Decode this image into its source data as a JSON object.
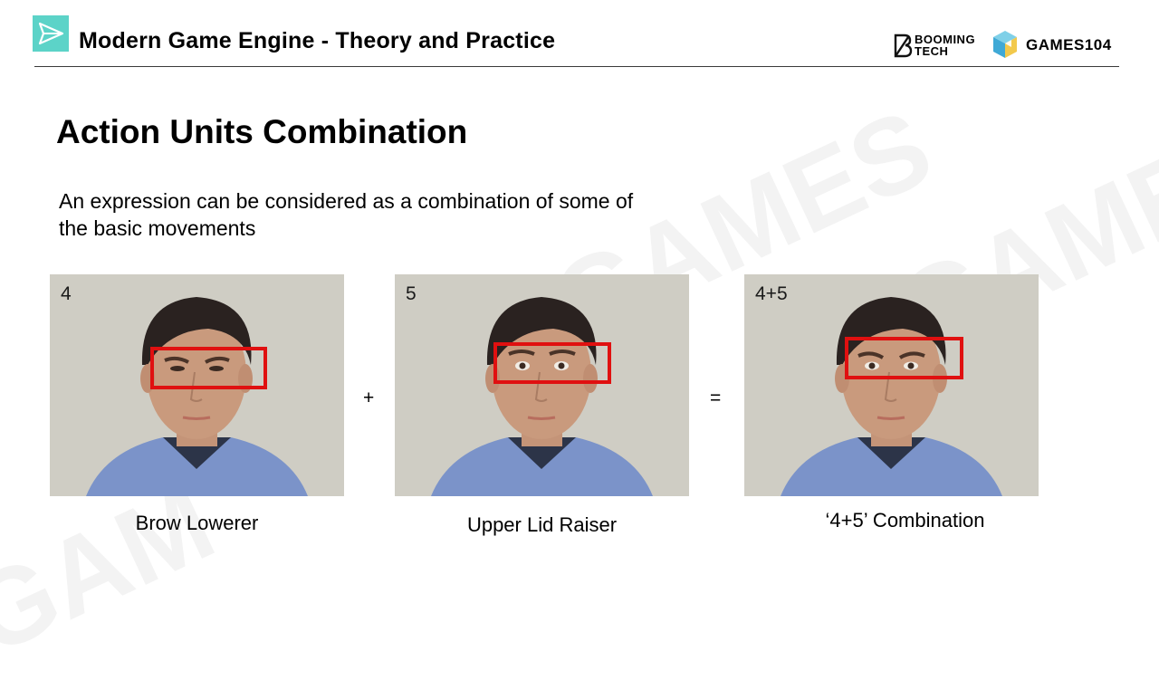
{
  "header": {
    "course_title": "Modern Game Engine - Theory and Practice",
    "brand_booming_line1": "BOOMING",
    "brand_booming_line2": "TECH",
    "brand_games": "GAMES104",
    "logo_icon": "paper-plane-icon"
  },
  "slide": {
    "title": "Action Units Combination",
    "body": "An expression can be considered as a combination of some of the basic movements"
  },
  "figures": [
    {
      "au_number": "4",
      "caption": "Brow Lowerer"
    },
    {
      "au_number": "5",
      "caption": "Upper Lid Raiser"
    },
    {
      "au_number": "4+5",
      "caption": "‘4+5’ Combination"
    }
  ],
  "operators": {
    "plus": "+",
    "equals": "="
  },
  "colors": {
    "highlight_box": "#e01010",
    "logo_teal": "#5cd3c8",
    "photo_background": "#c9c7c0",
    "shirt": "#7b93c9"
  }
}
